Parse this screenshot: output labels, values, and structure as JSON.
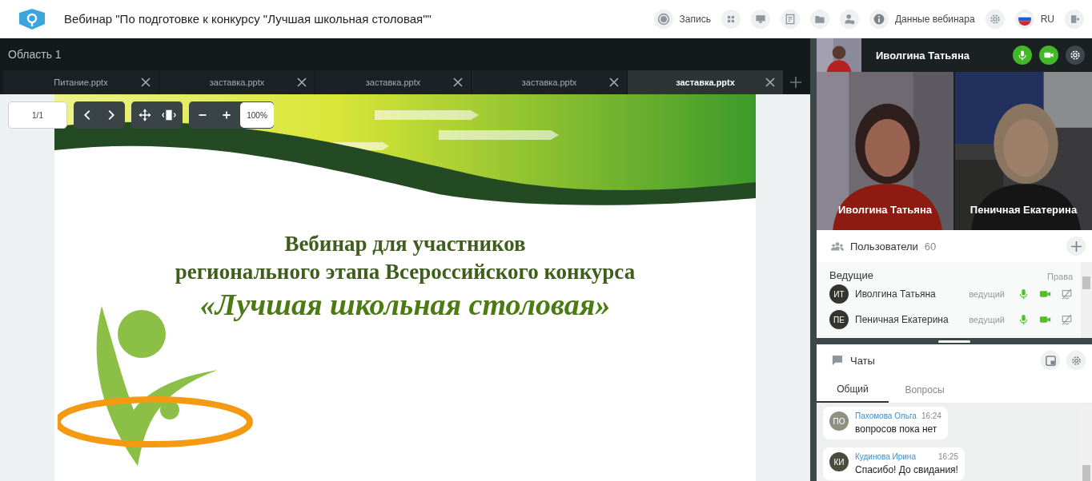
{
  "header": {
    "title": "Вебинар \"По подготовке к конкурсу \"Лучшая школьная столовая\"\"",
    "actions": [
      {
        "kind": "record",
        "label": "Запись"
      },
      {
        "kind": "grid"
      },
      {
        "kind": "screen"
      },
      {
        "kind": "document"
      },
      {
        "kind": "folder"
      },
      {
        "kind": "user"
      },
      {
        "kind": "info",
        "label": "Данные вебинара"
      },
      {
        "kind": "settings"
      },
      {
        "kind": "flag",
        "label": "RU"
      },
      {
        "kind": "exit"
      }
    ]
  },
  "workspace": {
    "title": "Область 1",
    "tabs": [
      {
        "label": "Питание.pptx",
        "selected": false
      },
      {
        "label": "заставка.pptx",
        "selected": false
      },
      {
        "label": "заставка.pptx",
        "selected": false
      },
      {
        "label": "заставка.pptx",
        "selected": false
      },
      {
        "label": "заставка.pptx",
        "selected": true
      }
    ],
    "viewer": {
      "page": "1/1",
      "zoom": "100%"
    },
    "slide": {
      "title_lines": [
        "Вебинар для участников",
        "регионального этапа Всероссийского конкурса"
      ],
      "subtitle": "«Лучшая школьная столовая»"
    }
  },
  "speaker": {
    "name": "Иволгина Татьяна"
  },
  "videos": [
    {
      "name": "Иволгина Татьяна"
    },
    {
      "name": "Пеничная Екатерина"
    }
  ],
  "users": {
    "title": "Пользователи",
    "count": "60",
    "group": "Ведущие",
    "rights_label": "Права",
    "rows": [
      {
        "initials": "ИТ",
        "name": "Иволгина Татьяна",
        "role": "ведущий"
      },
      {
        "initials": "ПЕ",
        "name": "Пеничная Екатерина",
        "role": "ведущий"
      }
    ]
  },
  "chat": {
    "title": "Чаты",
    "tabs": [
      {
        "label": "Общий",
        "selected": true
      },
      {
        "label": "Вопросы",
        "selected": false
      }
    ],
    "messages": [
      {
        "initials": "ПО",
        "author": "Пахомова Ольга",
        "time": "16:24",
        "text": "вопросов пока нет",
        "color": "#8c9180"
      },
      {
        "initials": "КИ",
        "author": "Кудинова Ирина",
        "time": "16:25",
        "text": "Спасибо! До свидания!",
        "color": "#4a4c3e"
      }
    ]
  }
}
